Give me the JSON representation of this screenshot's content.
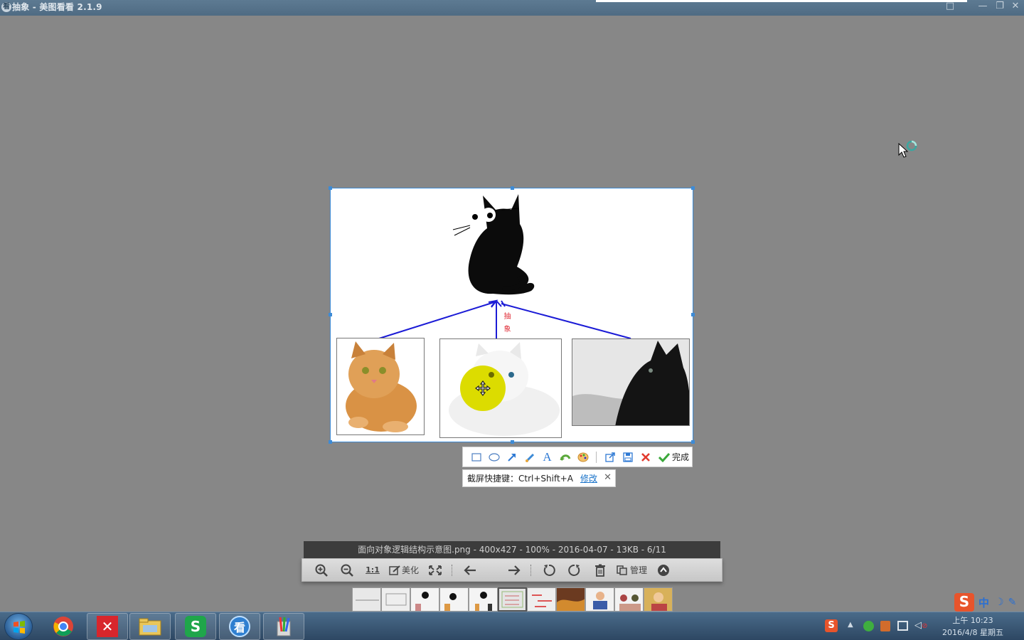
{
  "window": {
    "title": "抽象 - 美图看看 2.1.9",
    "app_icon_glyph": "看"
  },
  "diagram": {
    "abstract_label": "抽象"
  },
  "screenshot_toolbar": {
    "tools": [
      "rectangle-tool",
      "ellipse-tool",
      "arrow-tool",
      "brush-tool",
      "text-tool",
      "undo-tool",
      "color-tool"
    ],
    "actions": [
      "share-tool",
      "save-tool",
      "cancel-tool"
    ],
    "done_label": "完成",
    "accent": "#1a73c9"
  },
  "shortcut_tip": {
    "text": "截屏快捷键：Ctrl+Shift+A",
    "modify_label": "修改"
  },
  "info_bar": {
    "text": "面向对象逻辑结构示意图.png - 400x427 - 100% - 2016-04-07 - 13KB - 6/11"
  },
  "viewer_toolbar": {
    "actual_size_label": "1:1",
    "beautify_label": "美化",
    "manage_label": "管理"
  },
  "ime": {
    "label": "中"
  },
  "clock": {
    "time": "上午 10:23",
    "date": "2016/4/8 星期五"
  }
}
